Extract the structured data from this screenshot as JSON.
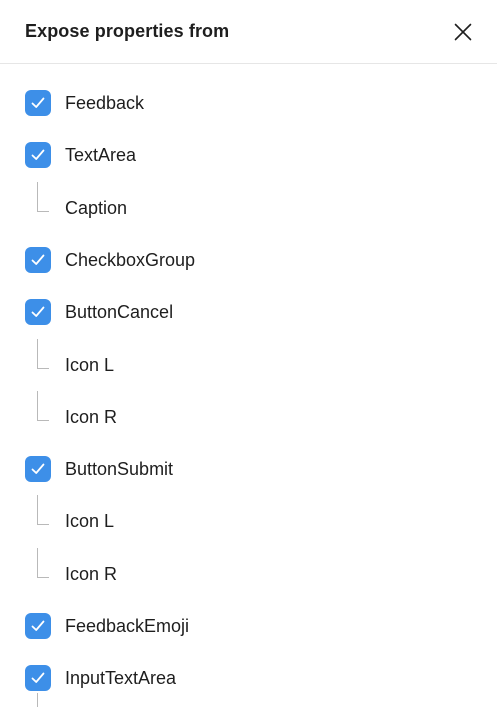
{
  "header": {
    "title": "Expose properties from",
    "close_icon": "close-icon"
  },
  "colors": {
    "checkbox_fill": "#3d8fe8",
    "checkmark": "#ffffff",
    "tree_line": "#b9b9b9",
    "text": "#1e1e1e",
    "divider": "#e6e6e6"
  },
  "items": [
    {
      "label": "Feedback",
      "kind": "checkbox",
      "checked": true
    },
    {
      "label": "TextArea",
      "kind": "checkbox",
      "checked": true
    },
    {
      "label": "Caption",
      "kind": "child"
    },
    {
      "label": "CheckboxGroup",
      "kind": "checkbox",
      "checked": true
    },
    {
      "label": "ButtonCancel",
      "kind": "checkbox",
      "checked": true
    },
    {
      "label": "Icon L",
      "kind": "child"
    },
    {
      "label": "Icon R",
      "kind": "child"
    },
    {
      "label": "ButtonSubmit",
      "kind": "checkbox",
      "checked": true
    },
    {
      "label": "Icon L",
      "kind": "child"
    },
    {
      "label": "Icon R",
      "kind": "child"
    },
    {
      "label": "FeedbackEmoji",
      "kind": "checkbox",
      "checked": true
    },
    {
      "label": "InputTextArea",
      "kind": "checkbox",
      "checked": true
    }
  ]
}
